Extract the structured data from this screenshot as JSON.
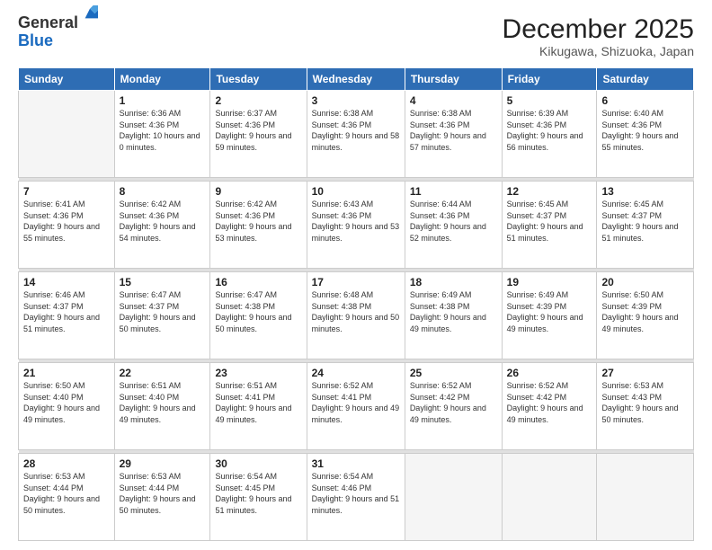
{
  "logo": {
    "general": "General",
    "blue": "Blue"
  },
  "header": {
    "month": "December 2025",
    "location": "Kikugawa, Shizuoka, Japan"
  },
  "days_of_week": [
    "Sunday",
    "Monday",
    "Tuesday",
    "Wednesday",
    "Thursday",
    "Friday",
    "Saturday"
  ],
  "weeks": [
    [
      {
        "day": "",
        "sunrise": "",
        "sunset": "",
        "daylight": "",
        "empty": true
      },
      {
        "day": "1",
        "sunrise": "Sunrise: 6:36 AM",
        "sunset": "Sunset: 4:36 PM",
        "daylight": "Daylight: 10 hours and 0 minutes."
      },
      {
        "day": "2",
        "sunrise": "Sunrise: 6:37 AM",
        "sunset": "Sunset: 4:36 PM",
        "daylight": "Daylight: 9 hours and 59 minutes."
      },
      {
        "day": "3",
        "sunrise": "Sunrise: 6:38 AM",
        "sunset": "Sunset: 4:36 PM",
        "daylight": "Daylight: 9 hours and 58 minutes."
      },
      {
        "day": "4",
        "sunrise": "Sunrise: 6:38 AM",
        "sunset": "Sunset: 4:36 PM",
        "daylight": "Daylight: 9 hours and 57 minutes."
      },
      {
        "day": "5",
        "sunrise": "Sunrise: 6:39 AM",
        "sunset": "Sunset: 4:36 PM",
        "daylight": "Daylight: 9 hours and 56 minutes."
      },
      {
        "day": "6",
        "sunrise": "Sunrise: 6:40 AM",
        "sunset": "Sunset: 4:36 PM",
        "daylight": "Daylight: 9 hours and 55 minutes."
      }
    ],
    [
      {
        "day": "7",
        "sunrise": "Sunrise: 6:41 AM",
        "sunset": "Sunset: 4:36 PM",
        "daylight": "Daylight: 9 hours and 55 minutes."
      },
      {
        "day": "8",
        "sunrise": "Sunrise: 6:42 AM",
        "sunset": "Sunset: 4:36 PM",
        "daylight": "Daylight: 9 hours and 54 minutes."
      },
      {
        "day": "9",
        "sunrise": "Sunrise: 6:42 AM",
        "sunset": "Sunset: 4:36 PM",
        "daylight": "Daylight: 9 hours and 53 minutes."
      },
      {
        "day": "10",
        "sunrise": "Sunrise: 6:43 AM",
        "sunset": "Sunset: 4:36 PM",
        "daylight": "Daylight: 9 hours and 53 minutes."
      },
      {
        "day": "11",
        "sunrise": "Sunrise: 6:44 AM",
        "sunset": "Sunset: 4:36 PM",
        "daylight": "Daylight: 9 hours and 52 minutes."
      },
      {
        "day": "12",
        "sunrise": "Sunrise: 6:45 AM",
        "sunset": "Sunset: 4:37 PM",
        "daylight": "Daylight: 9 hours and 51 minutes."
      },
      {
        "day": "13",
        "sunrise": "Sunrise: 6:45 AM",
        "sunset": "Sunset: 4:37 PM",
        "daylight": "Daylight: 9 hours and 51 minutes."
      }
    ],
    [
      {
        "day": "14",
        "sunrise": "Sunrise: 6:46 AM",
        "sunset": "Sunset: 4:37 PM",
        "daylight": "Daylight: 9 hours and 51 minutes."
      },
      {
        "day": "15",
        "sunrise": "Sunrise: 6:47 AM",
        "sunset": "Sunset: 4:37 PM",
        "daylight": "Daylight: 9 hours and 50 minutes."
      },
      {
        "day": "16",
        "sunrise": "Sunrise: 6:47 AM",
        "sunset": "Sunset: 4:38 PM",
        "daylight": "Daylight: 9 hours and 50 minutes."
      },
      {
        "day": "17",
        "sunrise": "Sunrise: 6:48 AM",
        "sunset": "Sunset: 4:38 PM",
        "daylight": "Daylight: 9 hours and 50 minutes."
      },
      {
        "day": "18",
        "sunrise": "Sunrise: 6:49 AM",
        "sunset": "Sunset: 4:38 PM",
        "daylight": "Daylight: 9 hours and 49 minutes."
      },
      {
        "day": "19",
        "sunrise": "Sunrise: 6:49 AM",
        "sunset": "Sunset: 4:39 PM",
        "daylight": "Daylight: 9 hours and 49 minutes."
      },
      {
        "day": "20",
        "sunrise": "Sunrise: 6:50 AM",
        "sunset": "Sunset: 4:39 PM",
        "daylight": "Daylight: 9 hours and 49 minutes."
      }
    ],
    [
      {
        "day": "21",
        "sunrise": "Sunrise: 6:50 AM",
        "sunset": "Sunset: 4:40 PM",
        "daylight": "Daylight: 9 hours and 49 minutes."
      },
      {
        "day": "22",
        "sunrise": "Sunrise: 6:51 AM",
        "sunset": "Sunset: 4:40 PM",
        "daylight": "Daylight: 9 hours and 49 minutes."
      },
      {
        "day": "23",
        "sunrise": "Sunrise: 6:51 AM",
        "sunset": "Sunset: 4:41 PM",
        "daylight": "Daylight: 9 hours and 49 minutes."
      },
      {
        "day": "24",
        "sunrise": "Sunrise: 6:52 AM",
        "sunset": "Sunset: 4:41 PM",
        "daylight": "Daylight: 9 hours and 49 minutes."
      },
      {
        "day": "25",
        "sunrise": "Sunrise: 6:52 AM",
        "sunset": "Sunset: 4:42 PM",
        "daylight": "Daylight: 9 hours and 49 minutes."
      },
      {
        "day": "26",
        "sunrise": "Sunrise: 6:52 AM",
        "sunset": "Sunset: 4:42 PM",
        "daylight": "Daylight: 9 hours and 49 minutes."
      },
      {
        "day": "27",
        "sunrise": "Sunrise: 6:53 AM",
        "sunset": "Sunset: 4:43 PM",
        "daylight": "Daylight: 9 hours and 50 minutes."
      }
    ],
    [
      {
        "day": "28",
        "sunrise": "Sunrise: 6:53 AM",
        "sunset": "Sunset: 4:44 PM",
        "daylight": "Daylight: 9 hours and 50 minutes."
      },
      {
        "day": "29",
        "sunrise": "Sunrise: 6:53 AM",
        "sunset": "Sunset: 4:44 PM",
        "daylight": "Daylight: 9 hours and 50 minutes."
      },
      {
        "day": "30",
        "sunrise": "Sunrise: 6:54 AM",
        "sunset": "Sunset: 4:45 PM",
        "daylight": "Daylight: 9 hours and 51 minutes."
      },
      {
        "day": "31",
        "sunrise": "Sunrise: 6:54 AM",
        "sunset": "Sunset: 4:46 PM",
        "daylight": "Daylight: 9 hours and 51 minutes."
      },
      {
        "day": "",
        "sunrise": "",
        "sunset": "",
        "daylight": "",
        "empty": true
      },
      {
        "day": "",
        "sunrise": "",
        "sunset": "",
        "daylight": "",
        "empty": true
      },
      {
        "day": "",
        "sunrise": "",
        "sunset": "",
        "daylight": "",
        "empty": true
      }
    ]
  ]
}
